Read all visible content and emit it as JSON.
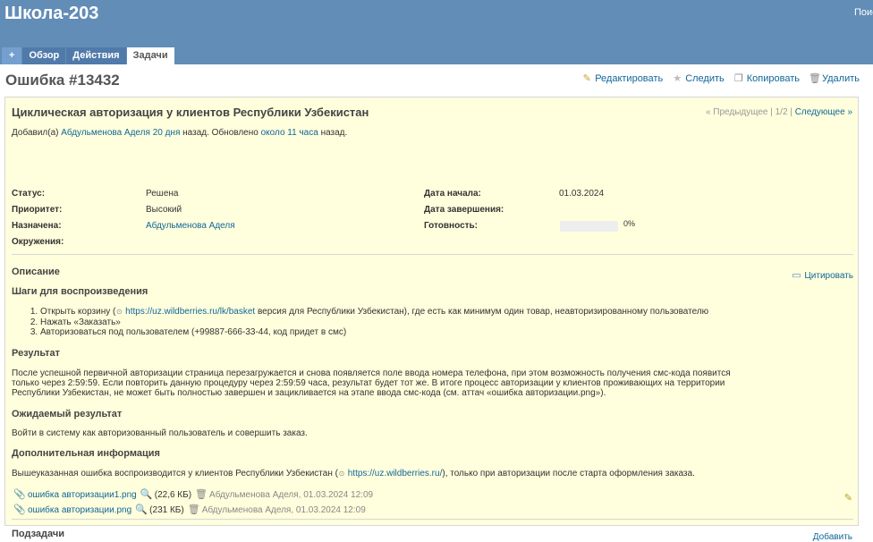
{
  "header": {
    "project_title": "Школа-203",
    "search_label": "Поис"
  },
  "menu": {
    "tabs": [
      {
        "label": "+"
      },
      {
        "label": "Обзор"
      },
      {
        "label": "Действия"
      },
      {
        "label": "Задачи"
      }
    ]
  },
  "issue": {
    "title": "Ошибка #13432",
    "actions": {
      "edit": "Редактировать",
      "watch": "Следить",
      "copy": "Копировать",
      "delete": "Удалить"
    },
    "subject": "Циклическая авторизация у клиентов Республики Узбекистан",
    "nav": {
      "prev": "« Предыдущее",
      "pos": "1/2",
      "next": "Следующее »"
    },
    "author_line": {
      "prefix": "Добавил(а)",
      "author": "Абдульменова Аделя",
      "age": "20 дня",
      "middle": "назад. Обновлено",
      "updated": "около 11 часа",
      "suffix": "назад."
    },
    "attrs": {
      "status_label": "Статус:",
      "status": "Решена",
      "priority_label": "Приоритет:",
      "priority": "Высокий",
      "assigned_label": "Назначена:",
      "assigned": "Абдульменова Аделя",
      "env_label": "Окружения:",
      "start_label": "Дата начала:",
      "start": "01.03.2024",
      "due_label": "Дата завершения:",
      "done_label": "Готовность:",
      "done": "0%"
    },
    "done_ratio": 0,
    "description": {
      "heading": "Описание",
      "quote": "Цитировать",
      "steps_heading": "Шаги для воспроизведения",
      "step1_pre": "Открыть корзину (",
      "step1_link": "https://uz.wildberries.ru/lk/basket",
      "step1_post": " версия для Республики Узбекистан), где есть как минимум один товар, неавторизированному пользователю",
      "step2": "Нажать «Заказать»",
      "step3": "Авторизоваться под пользователем (+99887-666-33-44, код придет в смс)",
      "result_heading": "Результат",
      "result_line1": "После успешной первичной авторизации страница перезагружается и снова появляется поле ввода номера телефона, при этом возможность получения смс-кода появится",
      "result_line2": "только через 2:59:59. Если повторить данную процедуру через 2:59:59 часа, результат будет тот же. В итоге процесс авторизации у клиентов проживающих на территории",
      "result_line3": "Республики Узбекистан, не может быть полностью завершен и зацикливается на этапе ввода смс-кода (см. аттач «ошибка авторизации.png»).",
      "expected_heading": "Ожидаемый результат",
      "expected": "Войти в систему как авторизованный пользователь и совершить заказ.",
      "extra_heading": "Дополнительная информация",
      "extra_pre": "Вышеуказанная ошибка воспроизводится у клиентов Республики Узбекистан (",
      "extra_link": "https://uz.wildberries.ru/",
      "extra_post": "), только при авторизации после старта оформления заказа."
    },
    "attachments": [
      {
        "name": "ошибка авторизации1.png",
        "size": "(22,6 КБ)",
        "meta": "Абдульменова Аделя, 01.03.2024 12:09"
      },
      {
        "name": "ошибка авторизации.png",
        "size": "(231 КБ)",
        "meta": "Абдульменова Аделя, 01.03.2024 12:09"
      }
    ],
    "subtasks": {
      "heading": "Подзадачи",
      "add": "Добавить"
    }
  }
}
